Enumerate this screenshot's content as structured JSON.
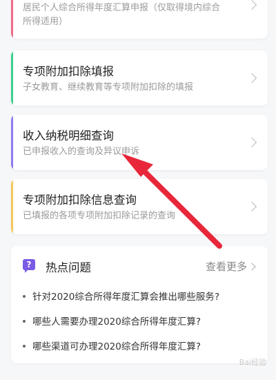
{
  "cards": [
    {
      "subtitle_l1": "居民个人综合所得年度汇算申报（仅取得境内综合",
      "subtitle_l2": "所得适用）",
      "accent": "#f06a8a"
    },
    {
      "title": "专项附加扣除填报",
      "subtitle": "子女教育、继续教育等专项附加扣除的填报",
      "accent": "#3ccf8e"
    },
    {
      "title": "收入纳税明细查询",
      "subtitle": "已申报收入的查询及异议申诉",
      "accent": "#8c7cf0"
    },
    {
      "title": "专项附加扣除信息查询",
      "subtitle": "已填报的各项专项附加扣除记录的查询",
      "accent": "#f7c55b"
    }
  ],
  "hot": {
    "icon_glyph": "?",
    "title": "热点问题",
    "more": "查看更多",
    "questions": [
      "针对2020综合所得年度汇算会推出哪些服务?",
      "哪些人需要办理2020综合所得年度汇算?",
      "哪些渠道可办理2020综合所得年度汇算?"
    ]
  },
  "annotation": {
    "arrow_color": "#e8273a"
  },
  "watermark": {
    "brand": "Bai",
    "suffix": "经验"
  }
}
